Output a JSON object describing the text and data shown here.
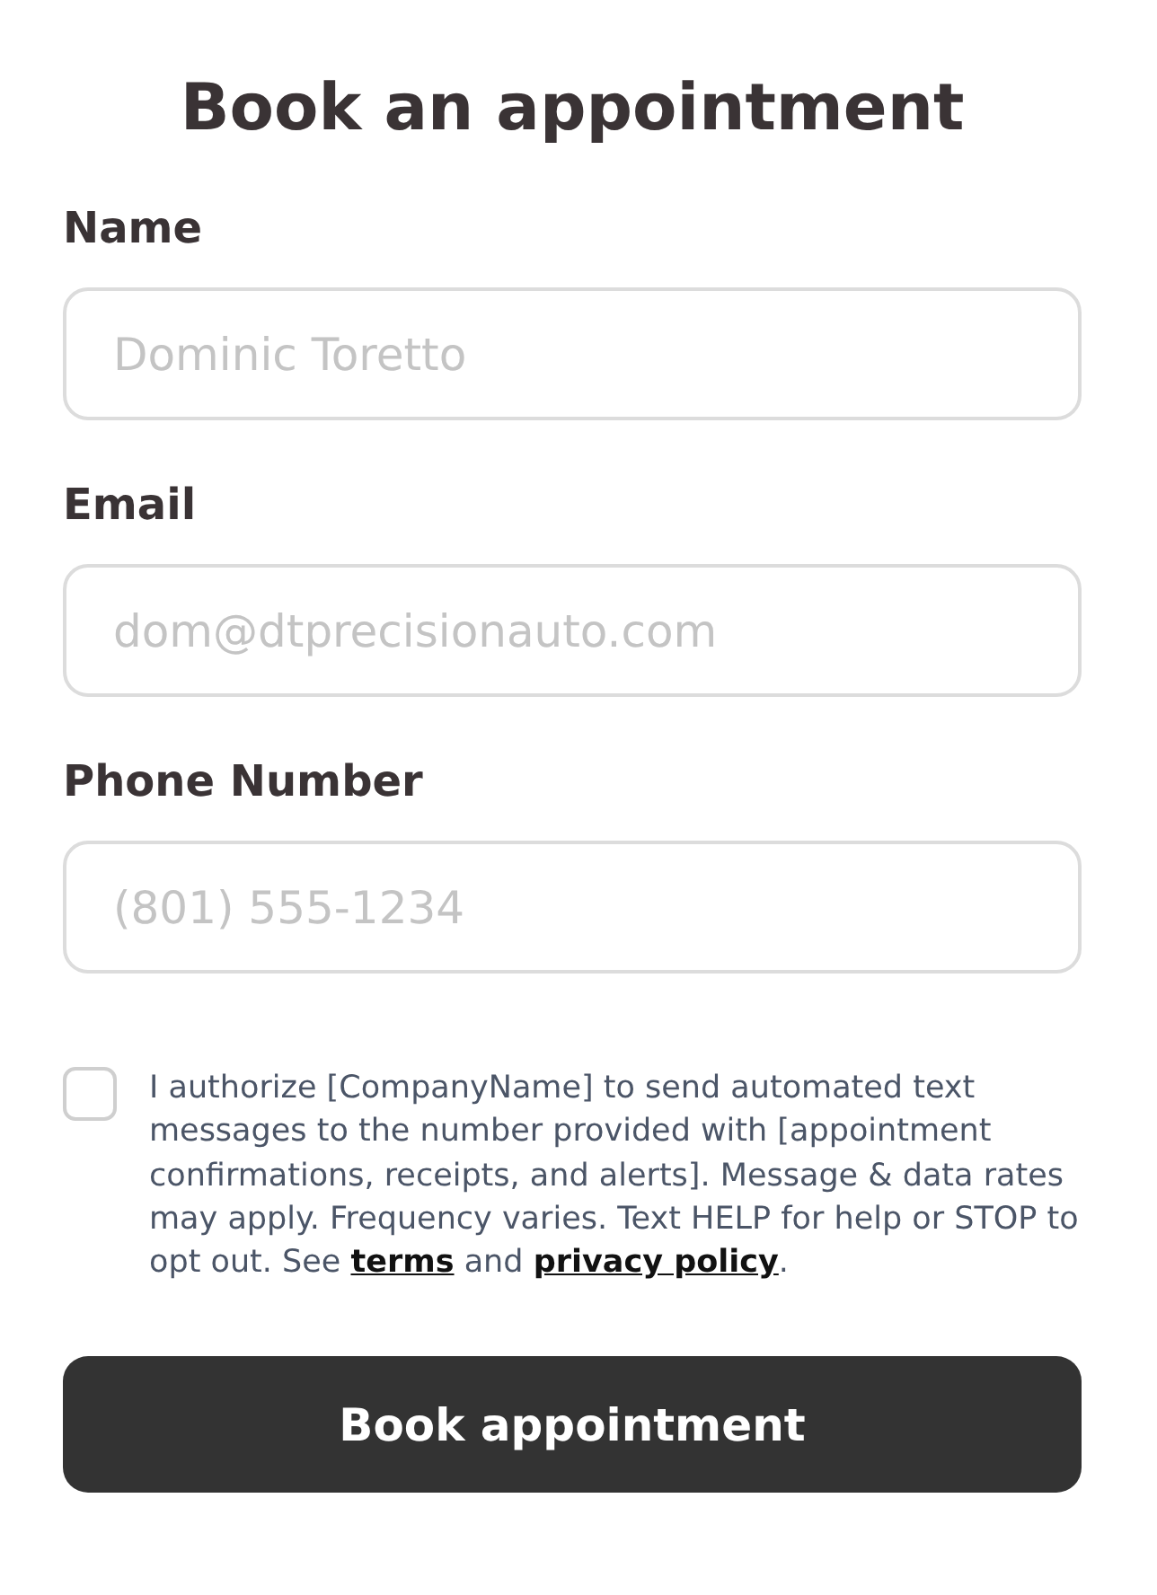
{
  "title": "Book an appointment",
  "fields": [
    {
      "label": "Name",
      "placeholder": "Dominic Toretto"
    },
    {
      "label": "Email",
      "placeholder": "dom@dtprecisionauto.com"
    },
    {
      "label": "Phone Number",
      "placeholder": "(801) 555-1234"
    }
  ],
  "consent": {
    "checked": false,
    "text": "I authorize [CompanyName] to send automated text messages to the number provided with [appointment confirmations, receipts, and alerts]. Message & data rates may apply. Frequency varies. Text HELP for help or STOP to opt out. See ",
    "terms_link": "terms",
    "middle": " and ",
    "privacy_link": "privacy policy",
    "end": "."
  },
  "submit_button": "Book appointment"
}
